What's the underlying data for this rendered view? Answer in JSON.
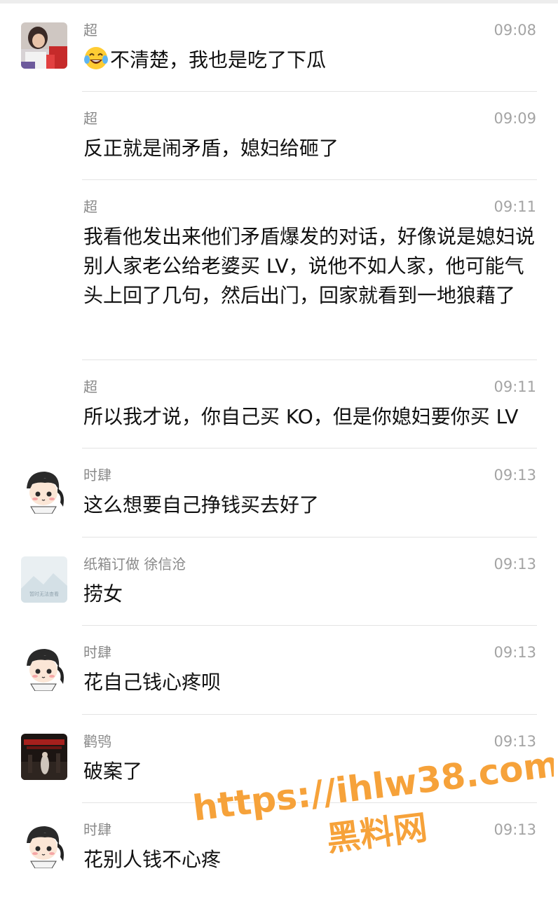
{
  "messages": [
    {
      "sender": "超",
      "time": "09:08",
      "emoji": "tears-of-joy-emoji",
      "text": "不清楚，我也是吃了下瓜",
      "avatar": "child-photo-avatar"
    },
    {
      "sender": "超",
      "time": "09:09",
      "text": "反正就是闹矛盾，媳妇给砸了"
    },
    {
      "sender": "超",
      "time": "09:11",
      "text": "我看他发出来他们矛盾爆发的对话，好像说是媳妇说别人家老公给老婆买 LV，说他不如人家，他可能气头上回了几句，然后出门，回家就看到一地狼藉了"
    },
    {
      "sender": "超",
      "time": "09:11",
      "text": "所以我才说，你自己买 KO，但是你媳妇要你买 LV"
    },
    {
      "sender": "时肆",
      "time": "09:13",
      "text": "这么想要自己挣钱买去好了",
      "avatar": "cartoon-boy-avatar"
    },
    {
      "sender": "纸箱订做 徐信沧",
      "time": "09:13",
      "text": "捞女",
      "avatar": "image-unavailable-avatar",
      "avatar_caption": "暂时无法查看"
    },
    {
      "sender": "时肆",
      "time": "09:13",
      "text": "花自己钱心疼呗",
      "avatar": "cartoon-boy-avatar"
    },
    {
      "sender": "鹳鸮",
      "time": "09:13",
      "text": "破案了",
      "avatar": "dark-poster-avatar"
    },
    {
      "sender": "时肆",
      "time": "09:13",
      "text": "花别人钱不心疼",
      "avatar": "cartoon-boy-avatar"
    }
  ],
  "watermark": {
    "line1": "https://ihlw38.com",
    "line2": "黑料网",
    "color": "#f6a23a"
  }
}
